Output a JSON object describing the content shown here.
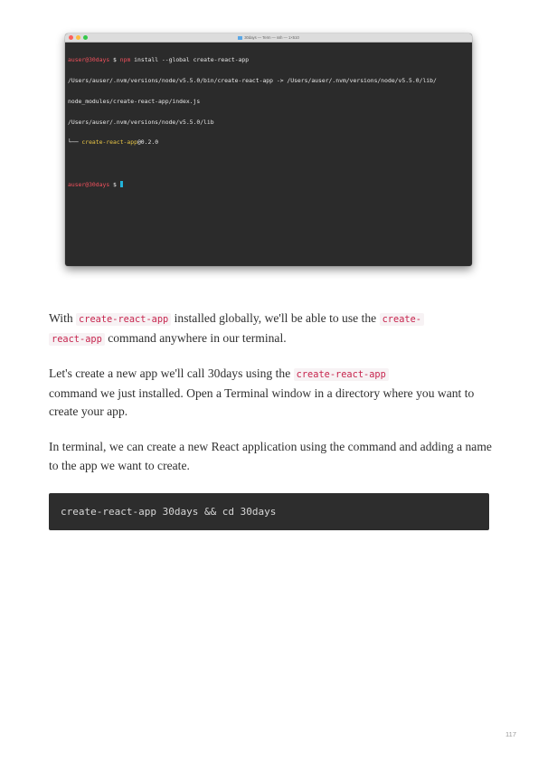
{
  "terminal": {
    "title": "30days — Term — ssh — 1×510",
    "prompt_user": "auser@30days",
    "prompt_symbol": "$",
    "command_tool": "npm",
    "command_args": "install --global create-react-app",
    "output_line_1": "/Users/auser/.nvm/versions/node/v5.5.0/bin/create-react-app -> /Users/auser/.nvm/versions/node/v5.5.0/lib/",
    "output_line_2": "node_modules/create-react-app/index.js",
    "output_line_3": "/Users/auser/.nvm/versions/node/v5.5.0/lib",
    "tree_prefix": "└── ",
    "package_name": "create-react-app",
    "package_version": "@0.2.0",
    "final_prompt_user": "auser@30days",
    "final_prompt_symbol": "$"
  },
  "paragraphs": {
    "p1": {
      "text_a": "With ",
      "code_a": "create-react-app",
      "text_b": " installed globally, we'll be able to use the ",
      "code_b_part1": "create-",
      "code_b_part2": "react-app",
      "text_c": " command anywhere in our terminal."
    },
    "p2": {
      "text_a": "Let's create a new app we'll call 30days using the ",
      "code_a": "create-react-app",
      "text_b": "command we just installed. Open a Terminal window in a directory where you want to create your app."
    },
    "p3": {
      "text": "In terminal, we can create a new React application using the command and adding a name to the app we want to create."
    }
  },
  "code_block": {
    "text": "create-react-app 30days && cd 30days"
  },
  "page_number": "117"
}
